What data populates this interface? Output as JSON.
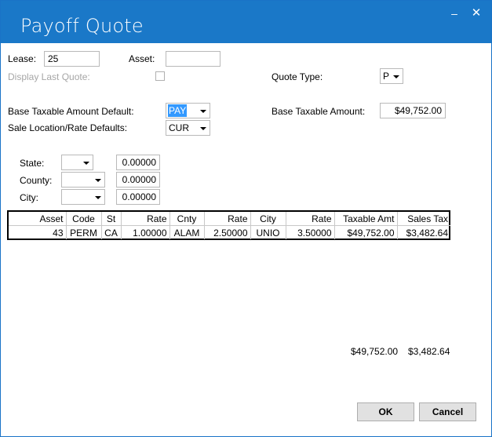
{
  "window": {
    "title": "Payoff Quote",
    "minimize_glyph": "–",
    "close_glyph": "✕"
  },
  "form": {
    "lease_label": "Lease:",
    "lease_value": "25",
    "asset_label": "Asset:",
    "asset_value": "",
    "display_last_quote_label": "Display Last Quote:",
    "quote_type_label": "Quote Type:",
    "quote_type_value": "P",
    "base_taxable_default_label": "Base Taxable Amount Default:",
    "base_taxable_default_value": "PAY",
    "base_taxable_amount_label": "Base Taxable Amount:",
    "base_taxable_amount_value": "$49,752.00",
    "sale_location_label": "Sale Location/Rate Defaults:",
    "sale_location_value": "CUR",
    "state_label": "State:",
    "state_value": "",
    "state_rate": "0.00000",
    "county_label": "County:",
    "county_value": "",
    "county_rate": "0.00000",
    "city_label": "City:",
    "city_value": "",
    "city_rate": "0.00000"
  },
  "grid": {
    "headers": [
      "Asset",
      "Code",
      "St",
      "Rate",
      "Cnty",
      "Rate",
      "City",
      "Rate",
      "Taxable Amt",
      "Sales Tax"
    ],
    "rows": [
      [
        "43",
        "PERM",
        "CA",
        "1.00000",
        "ALAM",
        "2.50000",
        "UNIO",
        "3.50000",
        "$49,752.00",
        "$3,482.64"
      ]
    ]
  },
  "totals": {
    "taxable": "$49,752.00",
    "sales_tax": "$3,482.64"
  },
  "buttons": {
    "ok": "OK",
    "cancel": "Cancel"
  }
}
